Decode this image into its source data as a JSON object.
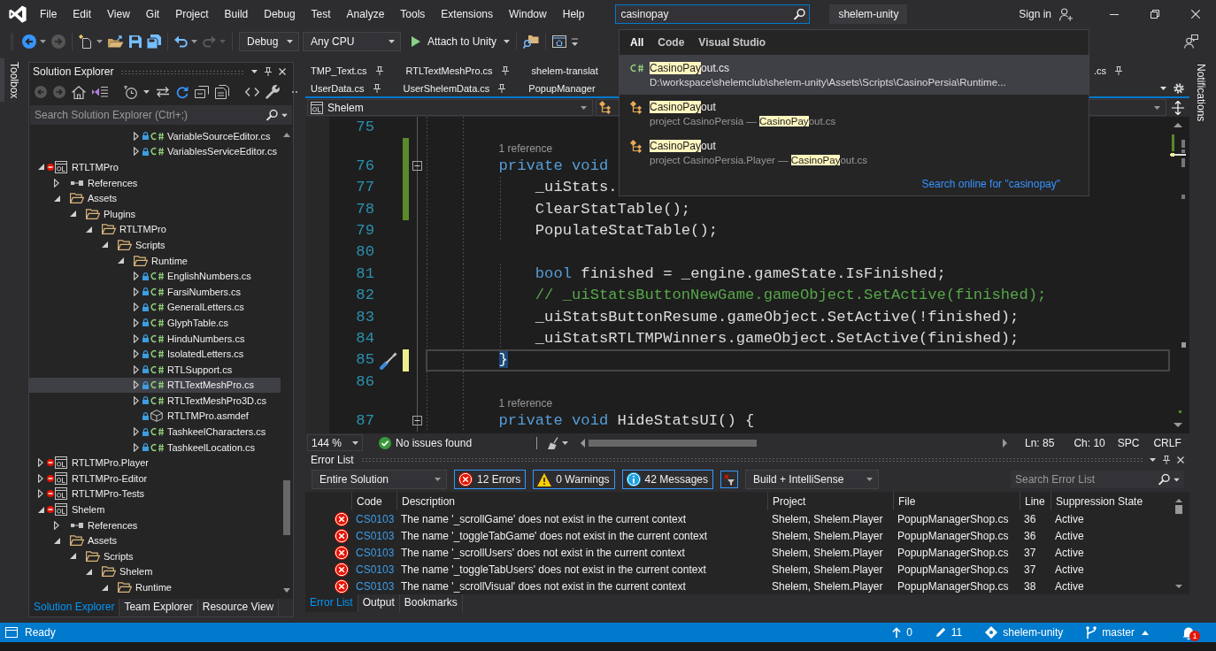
{
  "menu_bar": {
    "items": [
      "File",
      "Edit",
      "View",
      "Git",
      "Project",
      "Build",
      "Debug",
      "Test",
      "Analyze",
      "Tools",
      "Extensions",
      "Window",
      "Help"
    ],
    "search": {
      "value": "casinopay"
    },
    "solution_name": "shelem-unity",
    "sign_in": "Sign in"
  },
  "toolbar": {
    "configuration": "Debug",
    "platform": "Any CPU",
    "start": "Attach to Unity"
  },
  "search_popup": {
    "tabs": [
      {
        "label": "All",
        "selected": true
      },
      {
        "label": "Code",
        "selected": false
      },
      {
        "label": "Visual Studio",
        "selected": false
      }
    ],
    "results": [
      {
        "kind": "file",
        "selected": true,
        "title": [
          {
            "text": "CasinoPay",
            "match": true
          },
          {
            "text": "out.cs",
            "match": false
          }
        ],
        "detail": [
          {
            "text": "D:\\workspace\\shelemclub\\shelem-unity\\Assets\\Scripts\\CasinoPersia\\Runtime...",
            "match": false
          }
        ]
      },
      {
        "kind": "class",
        "selected": false,
        "title": [
          {
            "text": "CasinoPay",
            "match": true
          },
          {
            "text": "out",
            "match": false
          }
        ],
        "detail": [
          {
            "text": "project CasinoPersia — ",
            "match": false
          },
          {
            "text": "CasinoPay",
            "match": true
          },
          {
            "text": "out.cs",
            "match": false
          }
        ]
      },
      {
        "kind": "class",
        "selected": false,
        "title": [
          {
            "text": "CasinoPay",
            "match": true
          },
          {
            "text": "out",
            "match": false
          }
        ],
        "detail": [
          {
            "text": "project CasinoPersia.Player — ",
            "match": false
          },
          {
            "text": "CasinoPay",
            "match": true
          },
          {
            "text": "out.cs",
            "match": false
          }
        ]
      }
    ],
    "online_link": "Search online for \"casinopay\""
  },
  "toolbox_tab": "Toolbox",
  "solution_explorer": {
    "title": "Solution Explorer",
    "search": {
      "placeholder": "Search Solution Explorer (Ctrl+;)"
    },
    "tree": [
      {
        "children": [
          {
            "children": [
              {
                "children": [
                  {
                    "children": [
                      {
                        "children": [
                          {
                            "children": [
                              {
                                "label": "VariableSourceEditor.cs",
                                "kind": "file",
                                "locked": true,
                                "expanded": false,
                                "selected": false
                              },
                              {
                                "label": "VariablesServiceEditor.cs",
                                "kind": "file",
                                "locked": true,
                                "expanded": false,
                                "selected": false
                              }
                            ]
                          }
                        ]
                      }
                    ]
                  }
                ]
              }
            ]
          }
        ]
      },
      {
        "label": "RTLTMPro",
        "kind": "project",
        "excluded": true,
        "expanded": true,
        "selected": false,
        "children": [
          {
            "label": "References",
            "kind": "references",
            "expanded": false,
            "selected": false
          },
          {
            "label": "Assets",
            "kind": "folder",
            "expanded": true,
            "selected": false,
            "children": [
              {
                "label": "Plugins",
                "kind": "folder",
                "expanded": true,
                "selected": false,
                "children": [
                  {
                    "label": "RTLTMPro",
                    "kind": "folder",
                    "expanded": true,
                    "selected": false,
                    "children": [
                      {
                        "label": "Scripts",
                        "kind": "folder",
                        "expanded": true,
                        "selected": false,
                        "children": [
                          {
                            "label": "Runtime",
                            "kind": "folder",
                            "expanded": true,
                            "selected": false,
                            "children": [
                              {
                                "label": "EnglishNumbers.cs",
                                "kind": "file",
                                "locked": true,
                                "expanded": false,
                                "selected": false
                              },
                              {
                                "label": "FarsiNumbers.cs",
                                "kind": "file",
                                "locked": true,
                                "expanded": false,
                                "selected": false
                              },
                              {
                                "label": "GeneralLetters.cs",
                                "kind": "file",
                                "locked": true,
                                "expanded": false,
                                "selected": false
                              },
                              {
                                "label": "GlyphTable.cs",
                                "kind": "file",
                                "locked": true,
                                "expanded": false,
                                "selected": false
                              },
                              {
                                "label": "HinduNumbers.cs",
                                "kind": "file",
                                "locked": true,
                                "expanded": false,
                                "selected": false
                              },
                              {
                                "label": "IsolatedLetters.cs",
                                "kind": "file",
                                "locked": true,
                                "expanded": false,
                                "selected": false
                              },
                              {
                                "label": "RTLSupport.cs",
                                "kind": "file",
                                "locked": true,
                                "expanded": false,
                                "selected": false
                              },
                              {
                                "label": "RTLTextMeshPro.cs",
                                "kind": "file",
                                "locked": true,
                                "expanded": false,
                                "selected": true
                              },
                              {
                                "label": "RTLTextMeshPro3D.cs",
                                "kind": "file",
                                "locked": true,
                                "expanded": false,
                                "selected": false
                              },
                              {
                                "label": "RTLTMPro.asmdef",
                                "kind": "asmdef",
                                "locked": true,
                                "selected": false
                              },
                              {
                                "label": "TashkeelCharacters.cs",
                                "kind": "file",
                                "locked": true,
                                "expanded": false,
                                "selected": false
                              },
                              {
                                "label": "TashkeelLocation.cs",
                                "kind": "file",
                                "locked": true,
                                "expanded": false,
                                "selected": false
                              }
                            ]
                          }
                        ]
                      }
                    ]
                  }
                ]
              }
            ]
          }
        ]
      },
      {
        "label": "RTLTMPro.Player",
        "kind": "project",
        "excluded": true,
        "expanded": false,
        "selected": false
      },
      {
        "label": "RTLTMPro-Editor",
        "kind": "project",
        "excluded": true,
        "expanded": false,
        "selected": false
      },
      {
        "label": "RTLTMPro-Tests",
        "kind": "project",
        "excluded": true,
        "expanded": false,
        "selected": false
      },
      {
        "label": "Shelem",
        "kind": "project",
        "excluded": true,
        "expanded": true,
        "selected": false,
        "children": [
          {
            "label": "References",
            "kind": "references",
            "expanded": false,
            "selected": false
          },
          {
            "label": "Assets",
            "kind": "folder",
            "expanded": true,
            "selected": false,
            "children": [
              {
                "label": "Scripts",
                "kind": "folder",
                "expanded": true,
                "selected": false,
                "children": [
                  {
                    "label": "Shelem",
                    "kind": "folder",
                    "expanded": true,
                    "selected": false,
                    "children": [
                      {
                        "label": "Runtime",
                        "kind": "folder",
                        "expanded": true,
                        "selected": false
                      }
                    ]
                  }
                ]
              }
            ]
          }
        ]
      }
    ],
    "tabs": [
      {
        "label": "Solution Explorer",
        "selected": true
      },
      {
        "label": "Team Explorer",
        "selected": false
      },
      {
        "label": "Resource View",
        "selected": false
      }
    ]
  },
  "editor": {
    "tab_rows": [
      {
        "tabs": [
          {
            "label": "TMP_Text.cs",
            "pinned": true,
            "selected": false
          },
          {
            "label": "RTLTextMeshPro.cs",
            "pinned": true,
            "selected": false
          },
          {
            "label": "shelem-translat",
            "selected": false
          }
        ],
        "end_tabs": [
          {
            "label": ".cs",
            "pinned": true,
            "selected": false
          }
        ]
      },
      {
        "tabs": [
          {
            "label": "UserData.cs",
            "pinned": true,
            "selected": false
          },
          {
            "label": "UserShelemData.cs",
            "pinned": true,
            "selected": false
          },
          {
            "label": "PopupManager",
            "selected": false
          }
        ]
      }
    ],
    "project": "Shelem",
    "lines": [
      {
        "number": "75",
        "modified": false,
        "fold": false,
        "current": false,
        "quick_actions": false
      },
      {
        "number": "76",
        "codelens": "1 reference",
        "tokens": [
          {
            "kind": "keyword",
            "text": "        private void"
          }
        ],
        "modified": true,
        "saved": true,
        "fold": true,
        "current": false,
        "quick_actions": false
      },
      {
        "number": "77",
        "tokens": [
          {
            "kind": "plain",
            "text": "            _uiStats."
          }
        ],
        "modified": true,
        "saved": true,
        "fold": false,
        "current": false,
        "quick_actions": false
      },
      {
        "number": "78",
        "tokens": [
          {
            "kind": "plain",
            "text": "            ClearStatTable();"
          }
        ],
        "modified": true,
        "saved": true,
        "fold": false,
        "current": false,
        "quick_actions": false
      },
      {
        "number": "79",
        "tokens": [
          {
            "kind": "plain",
            "text": "            PopulateStatTable();"
          }
        ],
        "modified": false,
        "fold": false,
        "current": false,
        "quick_actions": false
      },
      {
        "number": "80",
        "modified": false,
        "fold": false,
        "current": false,
        "quick_actions": false
      },
      {
        "number": "81",
        "tokens": [
          {
            "kind": "keyword",
            "text": "            bool"
          },
          {
            "kind": "plain",
            "text": " finished = _engine.gameState.IsFinished;"
          }
        ],
        "modified": false,
        "fold": false,
        "current": false,
        "quick_actions": false
      },
      {
        "number": "82",
        "tokens": [
          {
            "kind": "comment",
            "text": "            // _uiStatsButtonNewGame.gameObject.SetActive(finished);"
          }
        ],
        "modified": false,
        "fold": false,
        "current": false,
        "quick_actions": false
      },
      {
        "number": "83",
        "tokens": [
          {
            "kind": "plain",
            "text": "            _uiStatsButtonResume.gameObject.SetActive(!finished);"
          }
        ],
        "modified": false,
        "fold": false,
        "current": false,
        "quick_actions": false
      },
      {
        "number": "84",
        "tokens": [
          {
            "kind": "plain",
            "text": "            _uiStatsRTLTMPWinners.gameObject.SetActive(finished);"
          }
        ],
        "modified": false,
        "fold": false,
        "current": false,
        "quick_actions": false
      },
      {
        "number": "85",
        "tokens": [
          {
            "kind": "brace_match",
            "text": "        }"
          }
        ],
        "modified": true,
        "saved": false,
        "fold": false,
        "current": true,
        "quick_actions": true
      },
      {
        "number": "86",
        "modified": false,
        "fold": false,
        "current": false,
        "quick_actions": false
      },
      {
        "number": "87",
        "codelens": "1 reference",
        "tokens": [
          {
            "kind": "keyword",
            "text": "        private void"
          },
          {
            "kind": "plain",
            "text": " HideStatsUI() {"
          }
        ],
        "modified": false,
        "fold": true,
        "current": false,
        "quick_actions": false
      }
    ],
    "status": {
      "zoom": "144 %",
      "issues": "No issues found",
      "line": "Ln: 85",
      "column": "Ch: 10",
      "whitespace": "SPC",
      "line_endings": "CRLF"
    }
  },
  "error_list": {
    "title": "Error List",
    "scope": "Entire Solution",
    "filters": [
      {
        "kind": "error",
        "label": "12 Errors",
        "selected": true
      },
      {
        "kind": "warning",
        "label": "0 Warnings",
        "selected": true
      },
      {
        "kind": "message",
        "label": "42 Messages",
        "selected": true
      }
    ],
    "source": "Build + IntelliSense",
    "search": {
      "placeholder": "Search Error List"
    },
    "columns": [
      "Code",
      "Description",
      "Project",
      "File",
      "Line",
      "Suppression State"
    ],
    "rows": [
      {
        "kind": "error",
        "code": "CS0103",
        "description": "The name '_scrollGame' does not exist in the current context",
        "project": "Shelem, Shelem.Player",
        "file": "PopupManagerShop.cs",
        "line": "36",
        "suppression": "Active"
      },
      {
        "kind": "error",
        "code": "CS0103",
        "description": "The name '_toggleTabGame' does not exist in the current context",
        "project": "Shelem, Shelem.Player",
        "file": "PopupManagerShop.cs",
        "line": "36",
        "suppression": "Active"
      },
      {
        "kind": "error",
        "code": "CS0103",
        "description": "The name '_scrollUsers' does not exist in the current context",
        "project": "Shelem, Shelem.Player",
        "file": "PopupManagerShop.cs",
        "line": "37",
        "suppression": "Active"
      },
      {
        "kind": "error",
        "code": "CS0103",
        "description": "The name '_toggleTabUsers' does not exist in the current context",
        "project": "Shelem, Shelem.Player",
        "file": "PopupManagerShop.cs",
        "line": "37",
        "suppression": "Active"
      },
      {
        "kind": "error",
        "code": "CS0103",
        "description": "The name '_scrollVisual' does not exist in the current context",
        "project": "Shelem, Shelem.Player",
        "file": "PopupManagerShop.cs",
        "line": "38",
        "suppression": "Active"
      }
    ],
    "tabs": [
      {
        "label": "Error List",
        "selected": true
      },
      {
        "label": "Output",
        "selected": false
      },
      {
        "label": "Bookmarks",
        "selected": false
      }
    ]
  },
  "notifications_tab": "Notifications",
  "status_bar": {
    "message": "Ready",
    "outgoing": "0",
    "changes": "11",
    "repository": "shelem-unity",
    "branch": "master",
    "notifications": "1"
  }
}
